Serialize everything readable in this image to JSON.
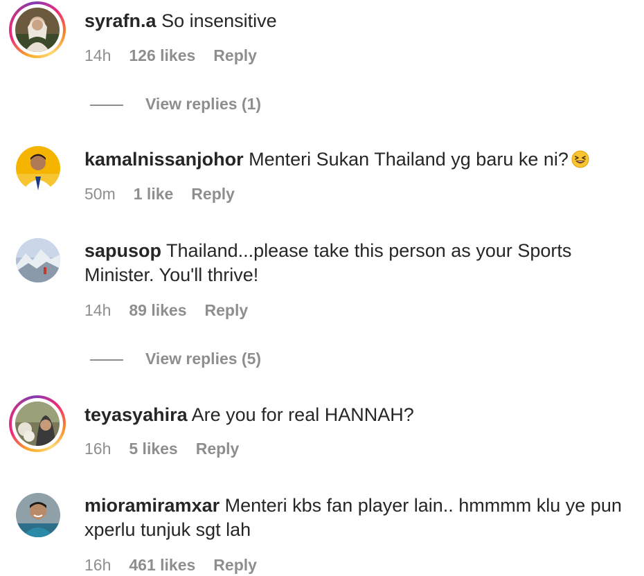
{
  "comments": [
    {
      "username": "syrafn.a",
      "text": "So insensitive",
      "time": "14h",
      "likes": "126 likes",
      "reply": "Reply",
      "view_replies": "View replies (1)",
      "avatar_icon": "user-avatar-icon",
      "has_story_ring": true
    },
    {
      "username": "kamalnissanjohor",
      "text": "Menteri Sukan Thailand yg baru ke ni?",
      "emoji": "😆",
      "time": "50m",
      "likes": "1 like",
      "reply": "Reply",
      "avatar_icon": "user-avatar-icon",
      "has_story_ring": false
    },
    {
      "username": "sapusop",
      "text": "Thailand...please take this person as your Sports Minister. You'll thrive!",
      "time": "14h",
      "likes": "89 likes",
      "reply": "Reply",
      "view_replies": "View replies (5)",
      "avatar_icon": "user-avatar-icon",
      "has_story_ring": false
    },
    {
      "username": "teyasyahira",
      "text": "Are you for real HANNAH?",
      "time": "16h",
      "likes": "5 likes",
      "reply": "Reply",
      "avatar_icon": "user-avatar-icon",
      "has_story_ring": true
    },
    {
      "username": "mioramiramxar",
      "text": "Menteri kbs fan player lain.. hmmmm klu ye pun xperlu tunjuk sgt lah",
      "time": "16h",
      "likes": "461 likes",
      "reply": "Reply",
      "avatar_icon": "user-avatar-icon",
      "has_story_ring": false
    }
  ],
  "colors": {
    "text": "#262626",
    "secondary": "#8e8e8e",
    "background": "#ffffff"
  }
}
